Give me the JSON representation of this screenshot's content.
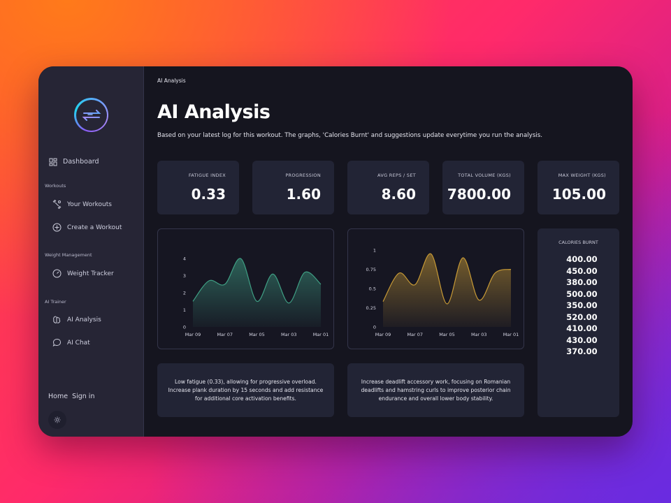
{
  "app": {
    "breadcrumb": "AI Analysis",
    "title": "AI Analysis",
    "subtitle": "Based on your latest log for this workout. The graphs, 'Calories Burnt' and suggestions update everytime you run the analysis."
  },
  "sidebar": {
    "dashboard": "Dashboard",
    "sections": {
      "workouts": "Workouts",
      "weight_management": "Weight Management",
      "ai_trainer": "AI Trainer"
    },
    "items": {
      "your_workouts": "Your Workouts",
      "create_workout": "Create a Workout",
      "weight_tracker": "Weight Tracker",
      "ai_analysis": "AI Analysis",
      "ai_chat": "AI Chat"
    },
    "home": "Home",
    "sign_in": "Sign in"
  },
  "stats": [
    {
      "label": "FATIGUE INDEX",
      "value": "0.33"
    },
    {
      "label": "PROGRESSION",
      "value": "1.60"
    },
    {
      "label": "AVG REPS / SET",
      "value": "8.60"
    },
    {
      "label": "TOTAL VOLUME (KGS)",
      "value": "7800.00"
    },
    {
      "label": "MAX WEIGHT (KGS)",
      "value": "105.00"
    }
  ],
  "calories": {
    "title": "CALORIES BURNT",
    "values": [
      "400.00",
      "450.00",
      "380.00",
      "500.00",
      "350.00",
      "520.00",
      "410.00",
      "430.00",
      "370.00"
    ]
  },
  "suggestions": [
    "Low fatigue (0.33), allowing for progressive overload. Increase plank duration by 15 seconds and add resistance for additional core activation benefits.",
    "Increase deadlift accessory work, focusing on Romanian deadlifts and hamstring curls to improve posterior chain endurance and overall lower body stability."
  ],
  "colors": {
    "chart1": "#3f9f84",
    "chart2": "#c79a36",
    "card": "#222435",
    "sidebar": "#262535"
  },
  "chart_data": [
    {
      "type": "area",
      "x": [
        "Mar 09",
        "Mar 07",
        "Mar 05",
        "Mar 03",
        "Mar 01"
      ],
      "x_ticks": [
        "Mar 09",
        "Mar 07",
        "Mar 05",
        "Mar 03",
        "Mar 01"
      ],
      "y_ticks": [
        "0",
        "1",
        "2",
        "3",
        "4"
      ],
      "ylim": [
        0,
        4.5
      ],
      "values": [
        1.5,
        2.7,
        2.5,
        4.0,
        1.5,
        3.1,
        1.4,
        3.2,
        2.5
      ],
      "color": "#3f9f84"
    },
    {
      "type": "area",
      "x": [
        "Mar 09",
        "Mar 07",
        "Mar 05",
        "Mar 03",
        "Mar 01"
      ],
      "x_ticks": [
        "Mar 09",
        "Mar 07",
        "Mar 05",
        "Mar 03",
        "Mar 01"
      ],
      "y_ticks": [
        "0",
        "0.25",
        "0.5",
        "0.75",
        "1"
      ],
      "ylim": [
        0,
        1
      ],
      "values": [
        0.33,
        0.7,
        0.55,
        0.95,
        0.3,
        0.9,
        0.35,
        0.7,
        0.75
      ],
      "color": "#c79a36"
    }
  ]
}
